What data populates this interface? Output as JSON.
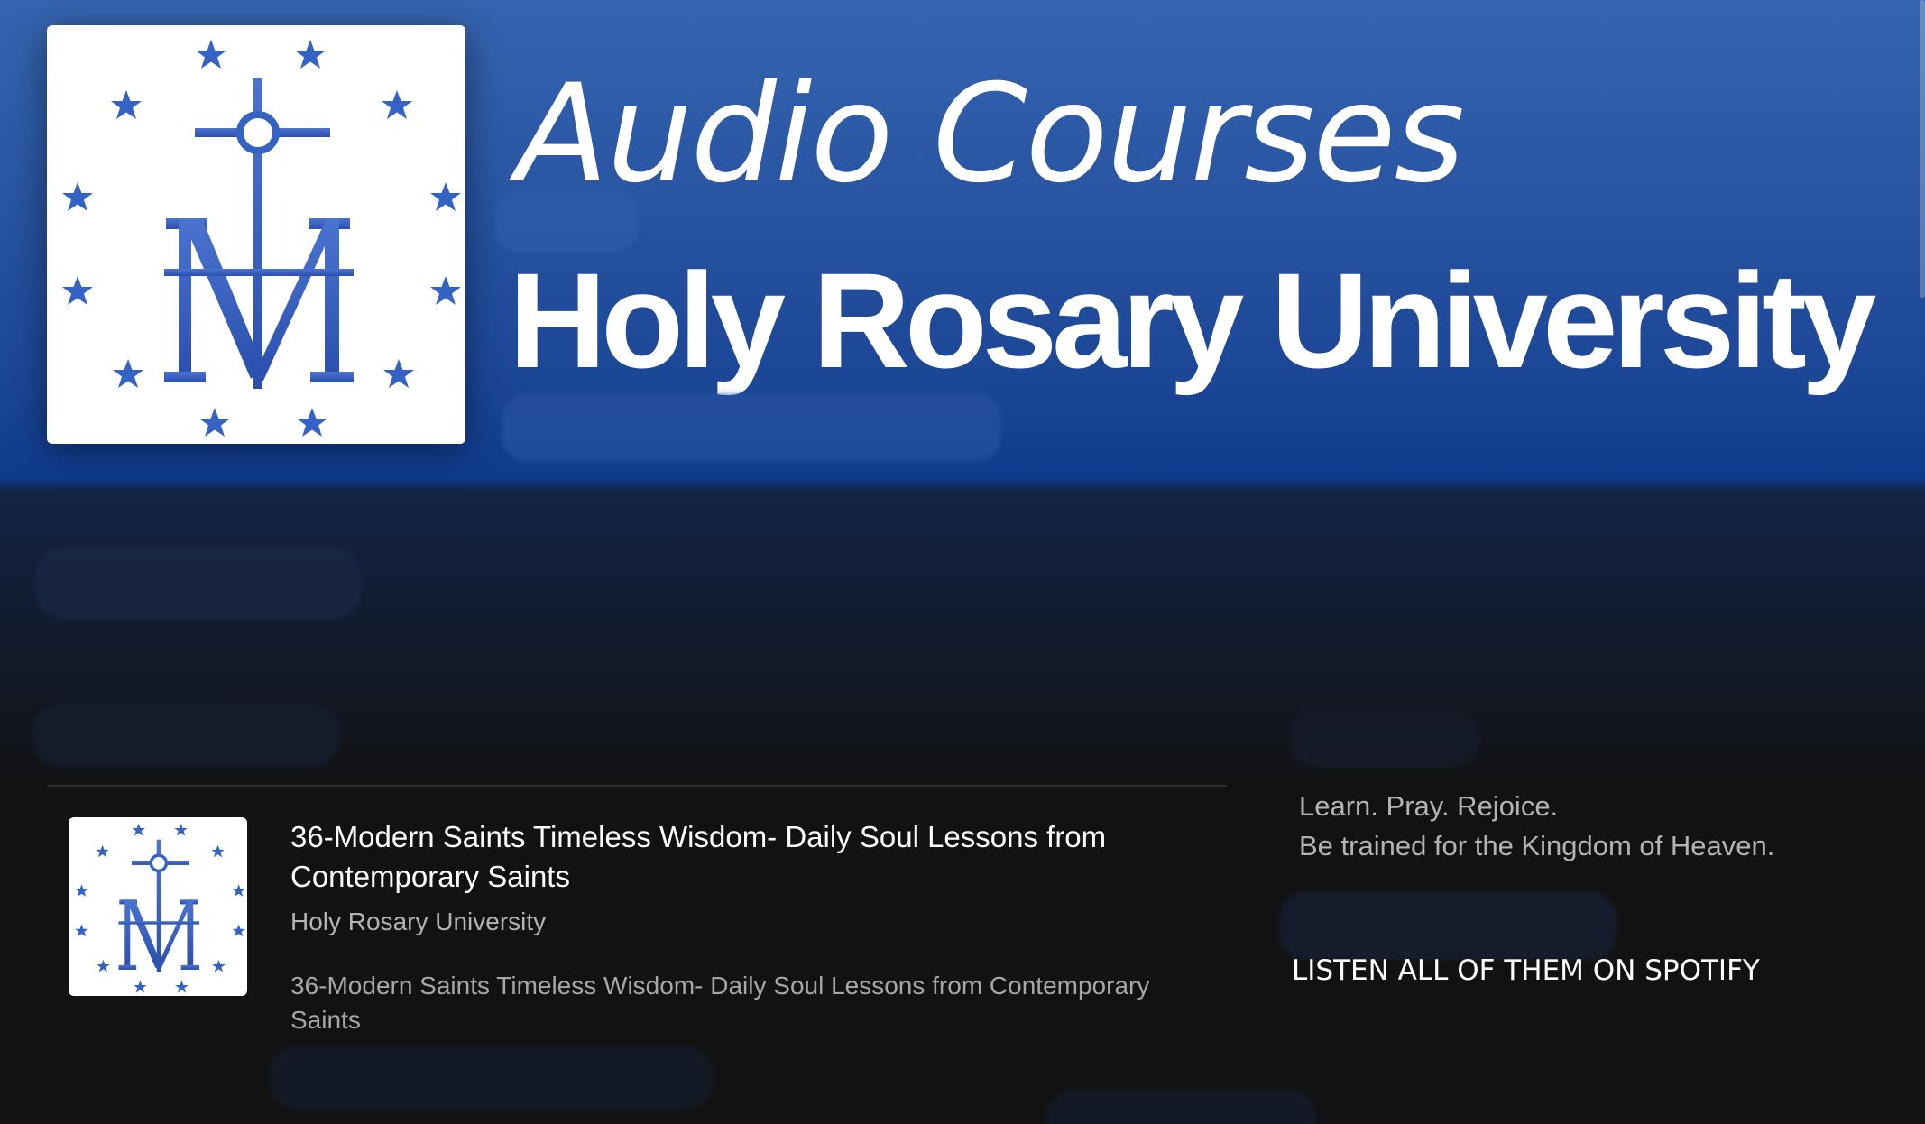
{
  "header": {
    "title_line1": "Audio Courses",
    "title_line2": "Holy Rosary University",
    "cover_icon": "marian-cross-m-logo-icon"
  },
  "episode": {
    "title": "36-Modern Saints Timeless Wisdom- Daily Soul Lessons from Contemporary Saints",
    "show": "Holy Rosary University",
    "description": "36-Modern Saints Timeless Wisdom- Daily Soul Lessons from Contemporary Saints",
    "thumb_icon": "marian-cross-m-logo-icon"
  },
  "sidebar": {
    "tagline_line1": "Learn. Pray. Rejoice.",
    "tagline_line2": "Be trained for the Kingdom of Heaven.",
    "spotify_link": "LISTEN ALL OF THEM ON SPOTIFY"
  },
  "colors": {
    "header_blue": "#2a56a3",
    "logo_blue": "#2e57b8",
    "background": "#121212"
  }
}
